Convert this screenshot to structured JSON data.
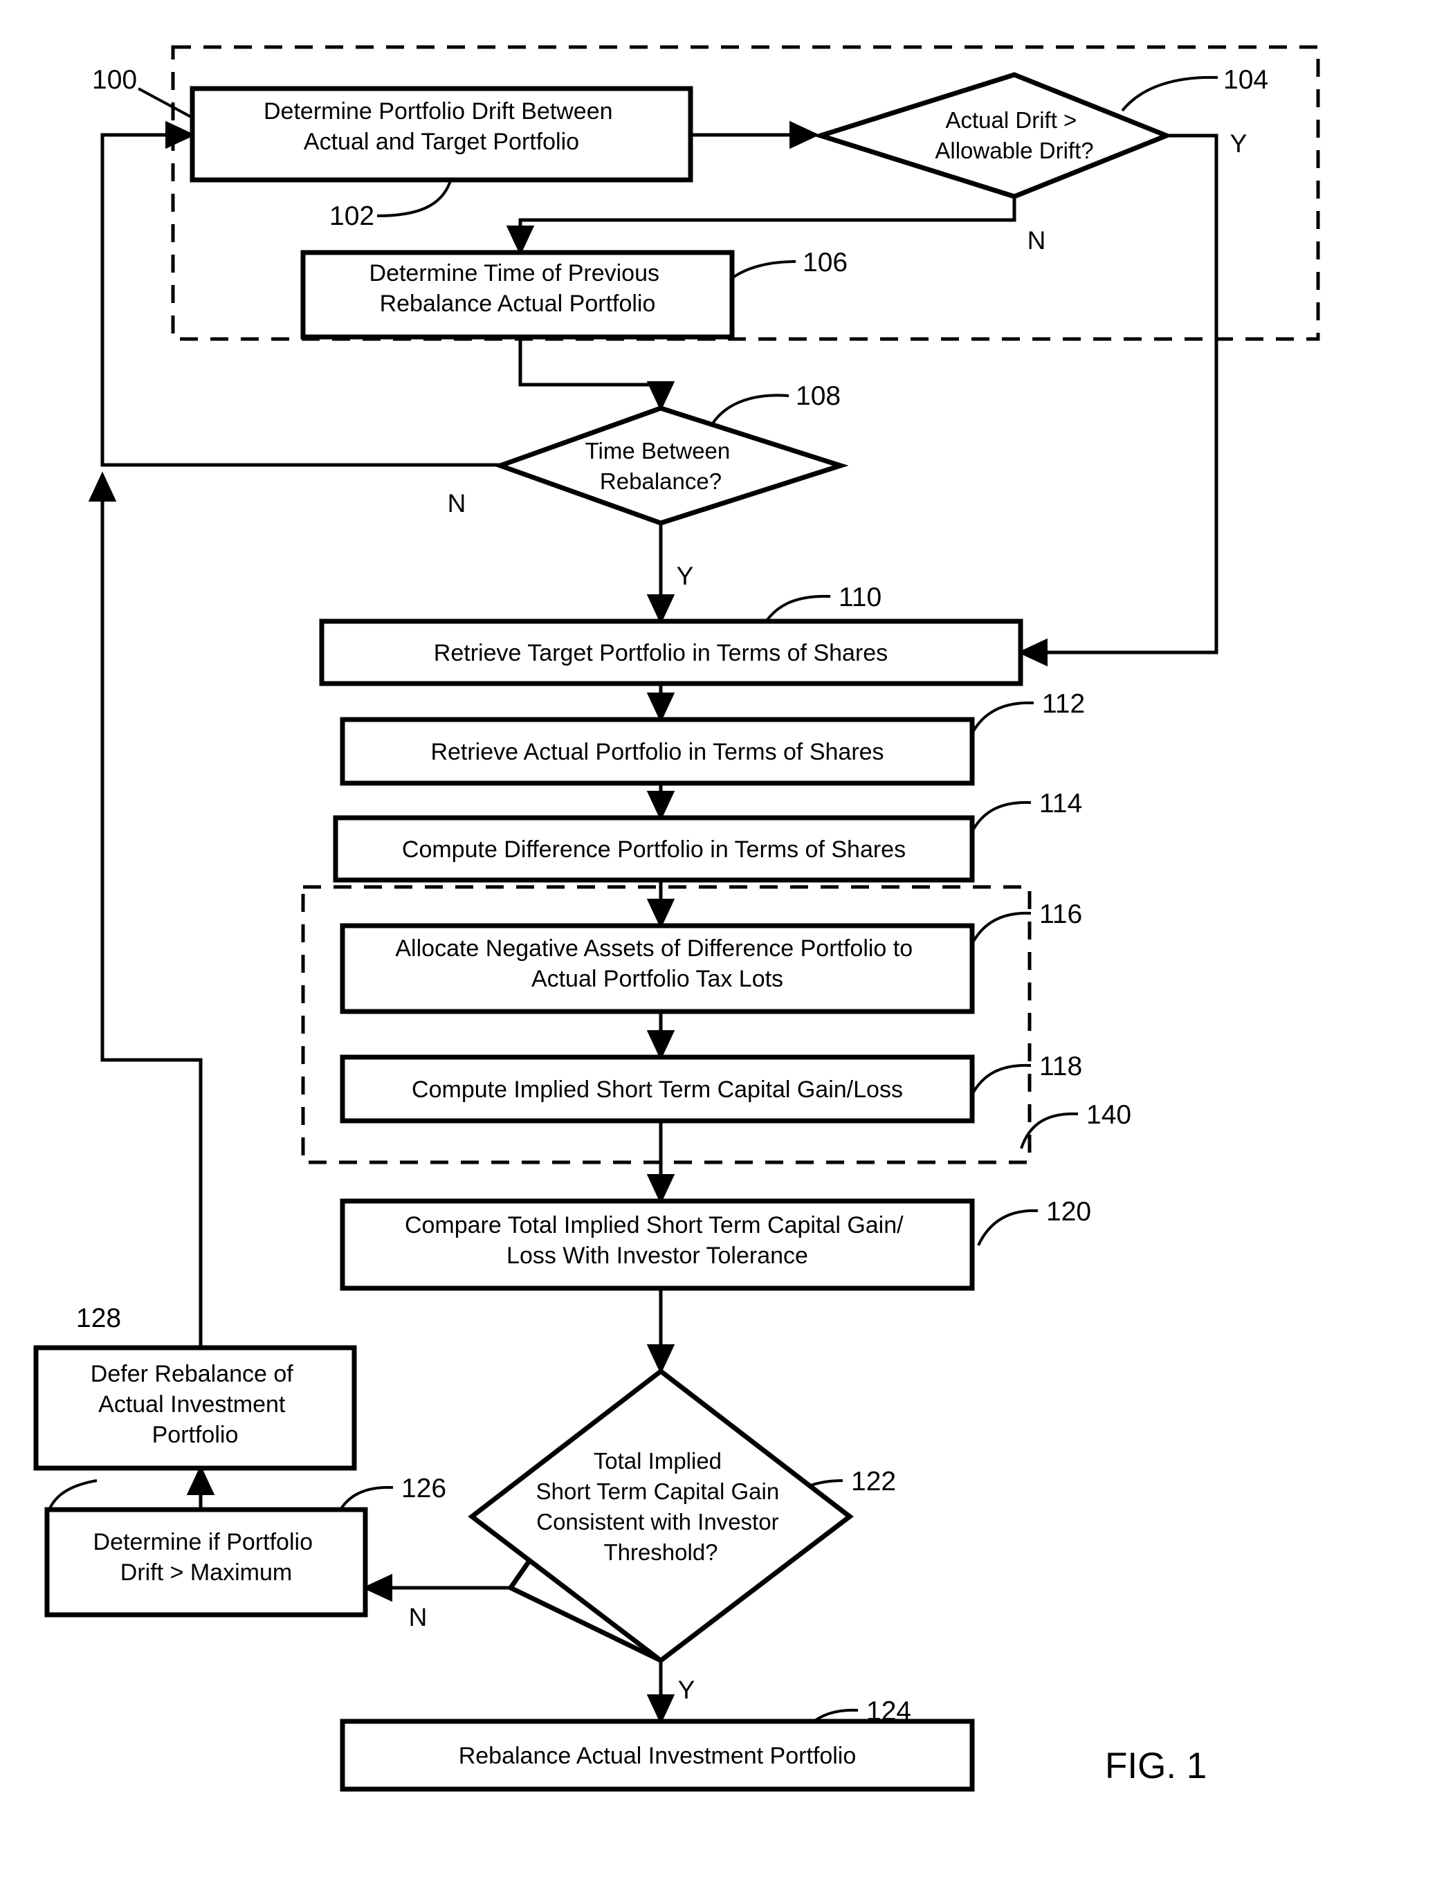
{
  "figure": {
    "label": "FIG. 1",
    "diagram_type": "flowchart",
    "overall_ref": "100"
  },
  "nodes": [
    {
      "id": "n102",
      "ref": "102",
      "shape": "process",
      "lines": [
        "Determine Portfolio Drift Between",
        "Actual and Target Portfolio"
      ]
    },
    {
      "id": "n104",
      "ref": "104",
      "shape": "decision",
      "lines": [
        "Actual Drift >",
        "Allowable Drift?"
      ]
    },
    {
      "id": "n106",
      "ref": "106",
      "shape": "process",
      "lines": [
        "Determine Time of Previous",
        "Rebalance Actual Portfolio"
      ]
    },
    {
      "id": "n108",
      "ref": "108",
      "shape": "decision",
      "lines": [
        "Time  Between",
        "Rebalance?"
      ]
    },
    {
      "id": "n110",
      "ref": "110",
      "shape": "process",
      "lines": [
        "Retrieve Target Portfolio in Terms of Shares"
      ]
    },
    {
      "id": "n112",
      "ref": "112",
      "shape": "process",
      "lines": [
        "Retrieve Actual Portfolio in Terms of Shares"
      ]
    },
    {
      "id": "n114",
      "ref": "114",
      "shape": "process",
      "lines": [
        "Compute Difference Portfolio in Terms of Shares"
      ]
    },
    {
      "id": "n116",
      "ref": "116",
      "shape": "process",
      "lines": [
        "Allocate Negative Assets of Difference Portfolio to",
        "Actual Portfolio Tax Lots"
      ]
    },
    {
      "id": "n118",
      "ref": "118",
      "shape": "process",
      "lines": [
        "Compute Implied Short Term Capital Gain/Loss"
      ]
    },
    {
      "id": "n120",
      "ref": "120",
      "shape": "process",
      "lines": [
        "Compare Total Implied Short Term Capital Gain/",
        "Loss With Investor Tolerance"
      ]
    },
    {
      "id": "n122",
      "ref": "122",
      "shape": "decision",
      "lines": [
        "Total Implied",
        "Short Term Capital Gain",
        "Consistent with Investor",
        "Threshold?"
      ]
    },
    {
      "id": "n124",
      "ref": "124",
      "shape": "process",
      "lines": [
        "Rebalance Actual Investment Portfolio"
      ]
    },
    {
      "id": "n126",
      "ref": "126",
      "shape": "process",
      "lines": [
        "Determine if Portfolio",
        "Drift > Maximum"
      ]
    },
    {
      "id": "n128",
      "ref": "128",
      "shape": "process",
      "lines": [
        "Defer Rebalance of",
        "Actual Investment",
        "Portfolio"
      ]
    }
  ],
  "groups": [
    {
      "id": "g_outer",
      "ref": "",
      "style": "dashed"
    },
    {
      "id": "g_140",
      "ref": "140",
      "style": "dashed"
    }
  ],
  "ref_numbers": {
    "r100": "100",
    "r102": "102",
    "r104": "104",
    "r106": "106",
    "r108": "108",
    "r110": "110",
    "r112": "112",
    "r114": "114",
    "r116": "116",
    "r118": "118",
    "r120": "120",
    "r122": "122",
    "r124": "124",
    "r126": "126",
    "r128": "128",
    "r140": "140"
  },
  "branch_labels": {
    "b104_y": "Y",
    "b104_n": "N",
    "b108_y": "Y",
    "b108_n": "N",
    "b122_y": "Y",
    "b122_n": "N"
  },
  "colors": {
    "stroke": "#000000",
    "fill": "#ffffff",
    "background": "#ffffff"
  }
}
